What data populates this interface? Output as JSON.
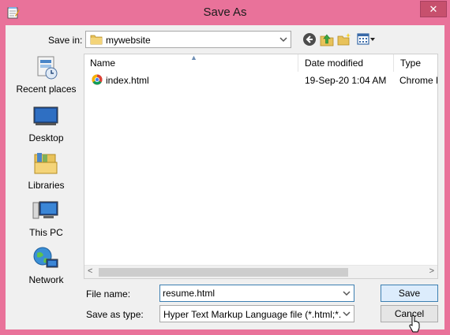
{
  "window": {
    "title": "Save As"
  },
  "toolbar": {
    "save_in_label": "Save in:",
    "folder": "mywebsite"
  },
  "places": [
    "Recent places",
    "Desktop",
    "Libraries",
    "This PC",
    "Network"
  ],
  "columns": {
    "name": "Name",
    "date": "Date modified",
    "type": "Type"
  },
  "files": [
    {
      "name": "index.html",
      "date": "19-Sep-20 1:04 AM",
      "type": "Chrome H"
    }
  ],
  "form": {
    "file_name_label": "File name:",
    "file_name_value": "resume.html",
    "save_type_label": "Save as type:",
    "save_type_value": "Hyper Text Markup Language file (*.html;*.htm;*"
  },
  "buttons": {
    "save": "Save",
    "cancel": "Cancel"
  },
  "icons": [
    "notepad-icon",
    "close-icon",
    "folder-icon",
    "back-icon",
    "up-folder-icon",
    "new-folder-icon",
    "view-menu-icon",
    "recent-places-icon",
    "desktop-icon",
    "libraries-icon",
    "this-pc-icon",
    "network-icon",
    "chrome-icon"
  ]
}
